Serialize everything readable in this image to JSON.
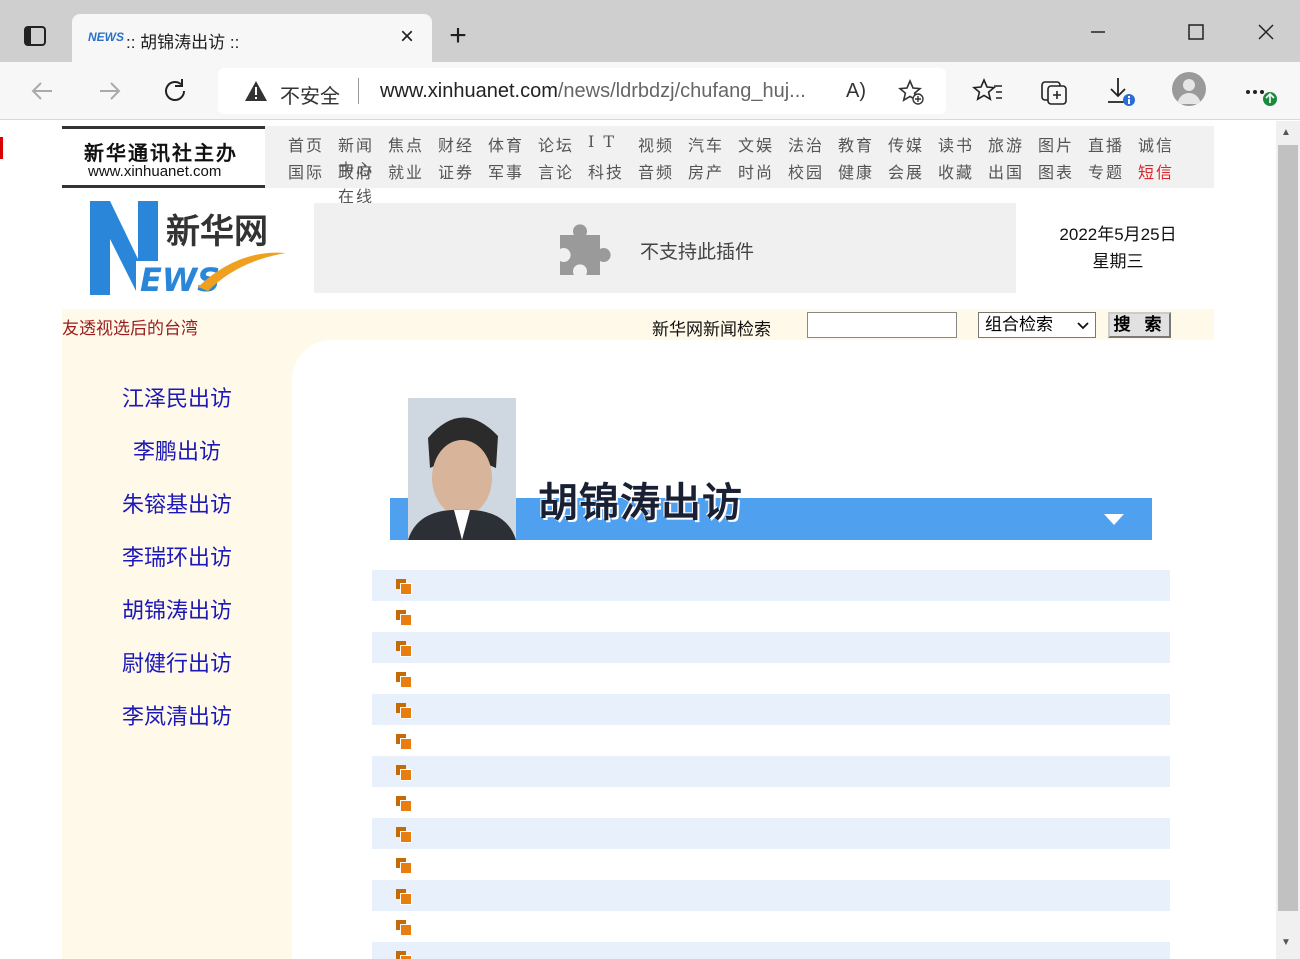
{
  "browser": {
    "tab_title": ":: 胡锦涛出访 ::",
    "tab_favicon_text": "NEWS",
    "tab_close": "×",
    "new_tab": "+",
    "address": {
      "security_label": "不安全",
      "url_host": "www.xinhuanet.com",
      "url_path": "/news/ldrbdzj/chufang_huj...",
      "read_aloud": "A)"
    }
  },
  "site": {
    "logo_line1": "新华通讯社主办",
    "logo_line2": "www.xinhuanet.com",
    "nav_row1": [
      "首页",
      "新闻中心",
      "焦点",
      "财经",
      "体育",
      "论坛",
      "I T",
      "视频",
      "汽车",
      "文娱",
      "法治",
      "教育",
      "传媒",
      "读书",
      "旅游",
      "图片",
      "直播",
      "诚信"
    ],
    "nav_row2": [
      "国际",
      "政府在线",
      "就业",
      "证券",
      "军事",
      "言论",
      "科技",
      "音频",
      "房产",
      "时尚",
      "校园",
      "健康",
      "会展",
      "收藏",
      "出国",
      "图表",
      "专题",
      "短信"
    ],
    "news_logo_text": "新华网",
    "plugin_message": "不支持此插件",
    "date": "2022年5月25日",
    "weekday": "星期三",
    "marquee": "友透视选后的台湾",
    "search_label": "新华网新闻检索",
    "search_value": "",
    "search_mode": "组合检索",
    "search_button": "搜 索"
  },
  "sidebar": {
    "links": [
      "江泽民出访",
      "李鹏出访",
      "朱镕基出访",
      "李瑞环出访",
      "胡锦涛出访",
      "尉健行出访",
      "李岚清出访"
    ]
  },
  "banner": {
    "title": "胡锦涛出访"
  },
  "list": {
    "row_count": 13
  },
  "colors": {
    "accent_blue": "#4fa0ef",
    "link_blue": "#1d19b8",
    "cream": "#fef9e9",
    "bullet_orange": "#e87d10"
  }
}
